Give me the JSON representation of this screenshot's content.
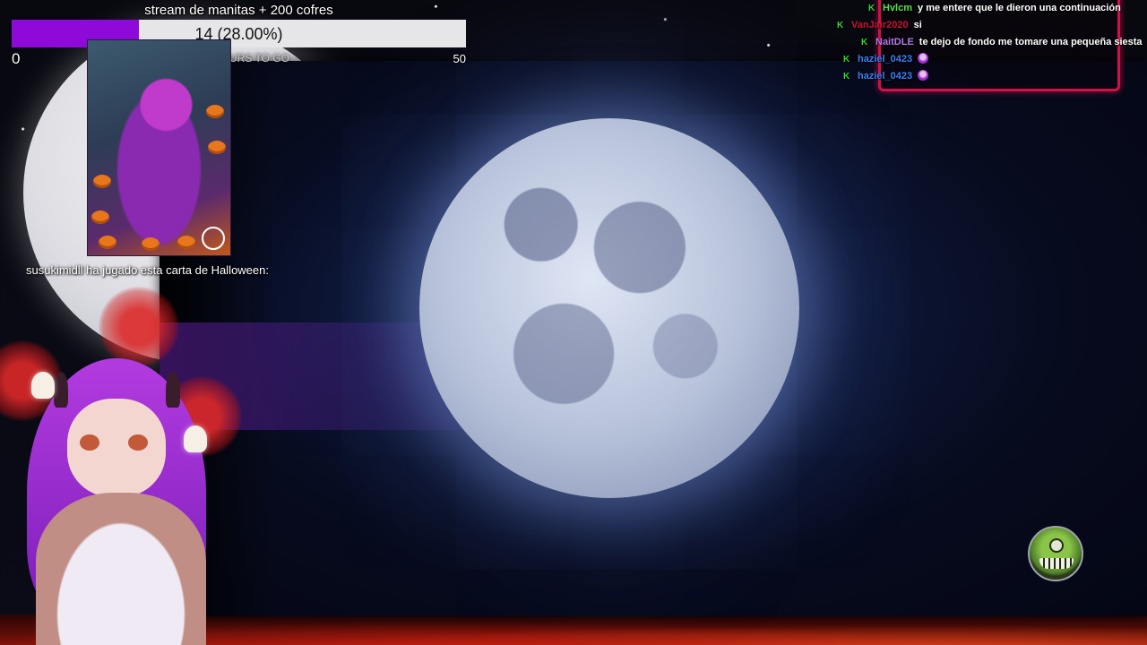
{
  "goal": {
    "title": "stream de manitas + 200 cofres",
    "value_text": "14 (28.00%)",
    "progress_fraction": 0.28,
    "min_label": "0",
    "subtext": "URS TO GO",
    "max_label": "50",
    "fill_color": "#8e0ad8"
  },
  "card_event": {
    "caption": "susukimidll ha jugado esta carta de Halloween:"
  },
  "chat": {
    "frame_color": "#d1114a",
    "messages": [
      {
        "user": "Hvlcm",
        "text": "y me entere que le dieron una continuación",
        "user_color": "#55e24a",
        "badge": "K",
        "emote": false
      },
      {
        "user": "VanJair2020",
        "text": "si",
        "user_color": "#d0103a",
        "badge": "K",
        "emote": false
      },
      {
        "user": "NaitDLE",
        "text": "te dejo de fondo me tomare una pequeña siesta",
        "user_color": "#b07ae8",
        "badge": "K",
        "emote": false
      },
      {
        "user": "haziel_0423",
        "text": "",
        "user_color": "#3d7ef2",
        "badge": "K",
        "emote": true
      },
      {
        "user": "haziel_0423",
        "text": "",
        "user_color": "#3d7ef2",
        "badge": "K",
        "emote": true
      }
    ]
  },
  "icons": {
    "overlay_logo": "green-monster-eye-icon",
    "chat_badge": "kick-badge-icon",
    "chat_emote": "purple-emote-icon"
  }
}
